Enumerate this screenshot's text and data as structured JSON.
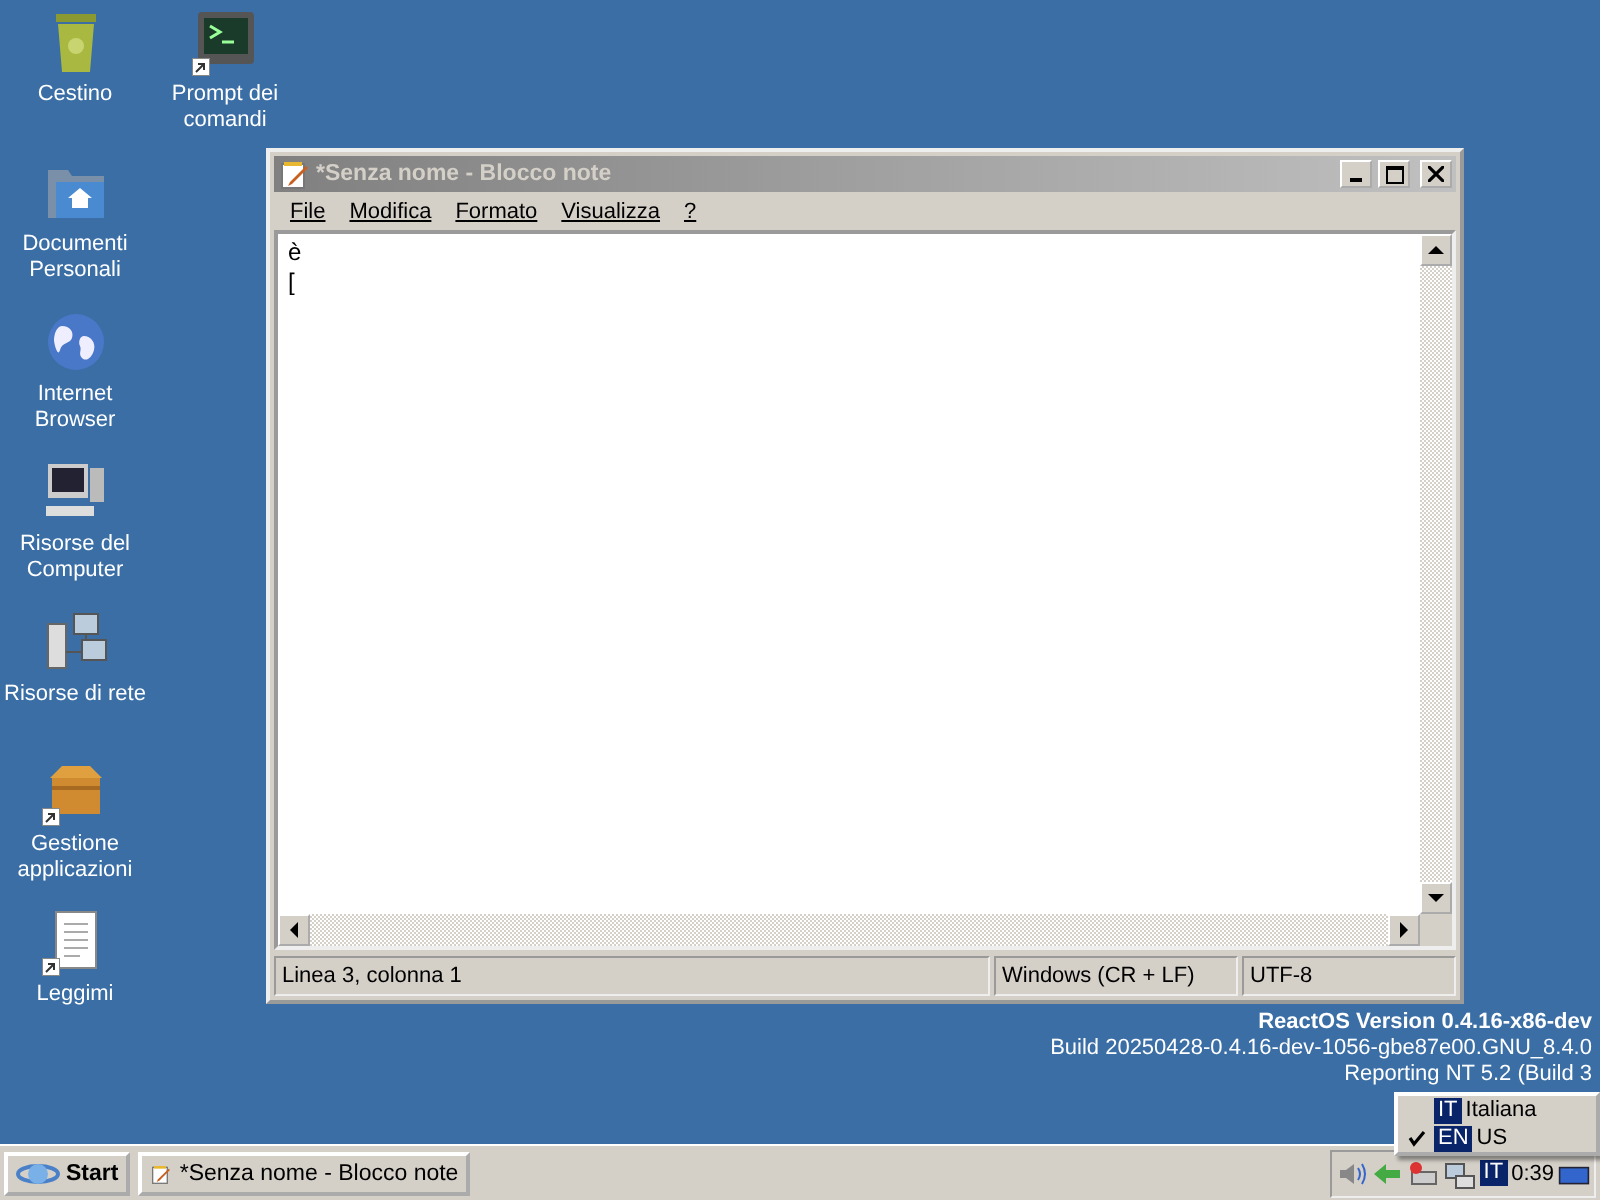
{
  "desktop_icons": [
    {
      "label": "Cestino",
      "kind": "bin",
      "shortcut": false
    },
    {
      "label": "Prompt dei comandi",
      "kind": "terminal",
      "shortcut": true
    },
    {
      "label": "Documenti Personali",
      "kind": "folder",
      "shortcut": false
    },
    {
      "label": "Internet Browser",
      "kind": "globe",
      "shortcut": false
    },
    {
      "label": "Risorse del Computer",
      "kind": "computer",
      "shortcut": false
    },
    {
      "label": "Risorse di rete",
      "kind": "network",
      "shortcut": false
    },
    {
      "label": "Gestione applicazioni",
      "kind": "box",
      "shortcut": true
    },
    {
      "label": "Leggimi",
      "kind": "document",
      "shortcut": true
    }
  ],
  "window": {
    "title": "*Senza nome - Blocco note",
    "active": false,
    "menu": [
      "File",
      "Modifica",
      "Formato",
      "Visualizza",
      "?"
    ],
    "text_lines": [
      "è",
      "["
    ],
    "status_bar": [
      "Linea 3, colonna 1",
      "Windows (CR + LF)",
      "UTF-8"
    ]
  },
  "version_info": [
    "ReactOS Version 0.4.16-x86-dev",
    "Build 20250428-0.4.16-dev-1056-gbe87e00.GNU_8.4.0",
    "Reporting NT 5.2 (Build 3"
  ],
  "taskbar": {
    "start": "Start",
    "tasks": [
      {
        "label": "*Senza nome - Blocco note",
        "selected": false
      }
    ],
    "tray": {
      "language": "IT",
      "clock": "0:39"
    }
  },
  "language_menu": [
    {
      "code": "IT",
      "label": "Italiana",
      "checked": false
    },
    {
      "code": "EN",
      "label": "US",
      "checked": true
    }
  ]
}
